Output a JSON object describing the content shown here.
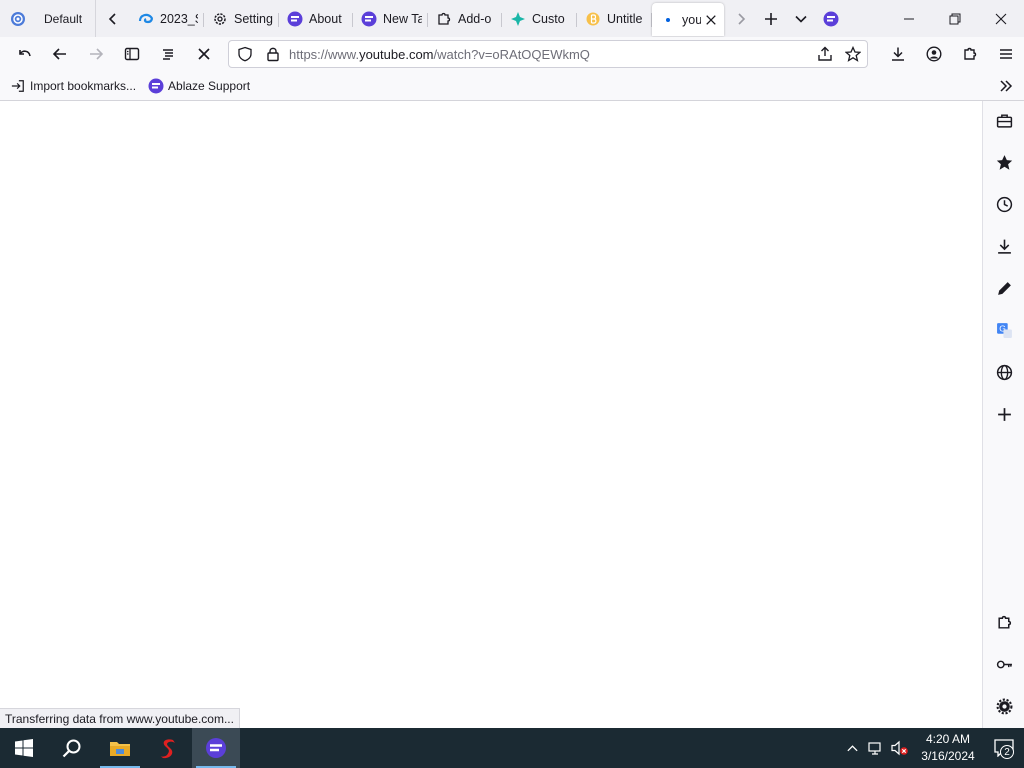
{
  "workspace": {
    "label": "Default"
  },
  "tabs": [
    {
      "label": "2023_S",
      "icon": "edge-browser-icon"
    },
    {
      "label": "Setting",
      "icon": "gear-icon"
    },
    {
      "label": "About",
      "icon": "ablaze-logo-icon"
    },
    {
      "label": "New Ta",
      "icon": "ablaze-logo-icon"
    },
    {
      "label": "Add-o",
      "icon": "puzzle-icon"
    },
    {
      "label": "Custo",
      "icon": "customize-icon"
    },
    {
      "label": "Untitle",
      "icon": "document-icon"
    },
    {
      "label": "you",
      "icon": "loading-dot-icon",
      "active": true
    }
  ],
  "urlbar": {
    "url_prefix": "https://www.",
    "url_host": "youtube.com",
    "url_path": "/watch?v=oRAtOQEWkmQ"
  },
  "bookmarks": [
    {
      "label": "Import bookmarks...",
      "icon": "import-icon"
    },
    {
      "label": "Ablaze Support",
      "icon": "ablaze-logo-icon"
    }
  ],
  "status": {
    "text": "Transferring data from www.youtube.com..."
  },
  "sidebar": {
    "items": [
      "toolbox-icon",
      "star-icon",
      "history-icon",
      "download-icon",
      "pen-icon",
      "translate-icon",
      "globe-icon",
      "plus-icon"
    ],
    "bottom_items": [
      "extension-icon",
      "key-icon",
      "gear-icon"
    ]
  },
  "taskbar": {
    "time": "4:20 AM",
    "date": "3/16/2024",
    "notification_count": "2"
  },
  "colors": {
    "accent": "#0061e0",
    "ablaze_purple": "#5b3fd9",
    "taskbar": "#1b2a33"
  }
}
